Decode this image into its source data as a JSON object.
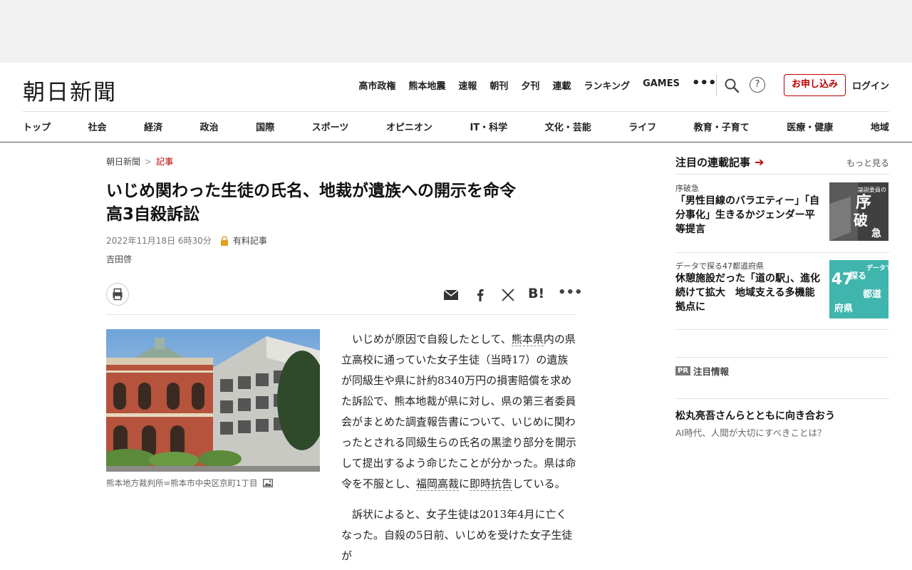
{
  "site": {
    "logo": "朝日新聞"
  },
  "header": {
    "top_links": [
      "高市政権",
      "熊本地震",
      "速報",
      "朝刊",
      "夕刊",
      "連載",
      "ランキング",
      "GAMES"
    ],
    "more": "•••",
    "help": "?",
    "apply_label": "お申し込み",
    "login_label": "ログイン"
  },
  "nav": [
    "トップ",
    "社会",
    "経済",
    "政治",
    "国際",
    "スポーツ",
    "オピニオン",
    "IT・科学",
    "文化・芸能",
    "ライフ",
    "教育・子育て",
    "医療・健康",
    "地域"
  ],
  "breadcrumb": {
    "home": "朝日新聞",
    "sep": ">",
    "current": "記事"
  },
  "article": {
    "headline_line1": "いじめ関わった生徒の氏名、地裁が遺族への開示を命令",
    "headline_line2": "高3自殺訴訟",
    "date": "2022年11月18日 6時30分",
    "paid_label": "有料記事",
    "author": "吉田啓",
    "share_hatena": "B!",
    "share_more": "•••",
    "photo_caption": "熊本地方裁判所=熊本市中央区京町1丁目",
    "p1": {
      "a": "いじめが原因で自殺したとして、",
      "k1": "熊本県",
      "b": "内の県立高校に通っていた女子生徒（当時17）の遺族が同級生や県に計約8340万円の損害賠償を求めた訴訟で、熊本地裁が県に対し、県の第三者委員会がまとめた調査報告書について、いじめに関わったとされる同級生らの氏名の黒塗り部分を開示して提出するよう命じたことが分かった。県は命令を不服とし、",
      "k2": "福岡高裁",
      "c": "に",
      "k3": "即時抗告",
      "d": "している。"
    },
    "p2": "訴状によると、女子生徒は2013年4月に亡くなった。自殺の5日前、いじめを受けた女子生徒が"
  },
  "sidebar": {
    "heading": "注目の連載記事",
    "heading_arrow": "➔",
    "more_label": "もっと見る",
    "cards": [
      {
        "category": "序破急",
        "title": "「男性目線のバラエティー」「自分事化」生きるかジェンダー平等提言",
        "thumb_text1": "論説委員の",
        "thumb_text2": "序",
        "thumb_text3": "破",
        "thumb_text4": "急"
      },
      {
        "category": "データで探る47都道府県",
        "title": "休憩施設だった「道の駅」、進化続けて拡大　地域支える多機能拠点に",
        "thumb_num": "47",
        "thumb_text1": "データで",
        "thumb_text2": "探る",
        "thumb_text3": "都道",
        "thumb_text4": "府県"
      }
    ]
  },
  "pr": {
    "badge": "PR",
    "title": "注目情報",
    "item_title": "松丸亮吾さんらとともに向き合おう",
    "item_sub": "AI時代、人間が大切にすべきことは？"
  },
  "colors": {
    "accent": "#b00000",
    "nav_rule": "#555555"
  }
}
